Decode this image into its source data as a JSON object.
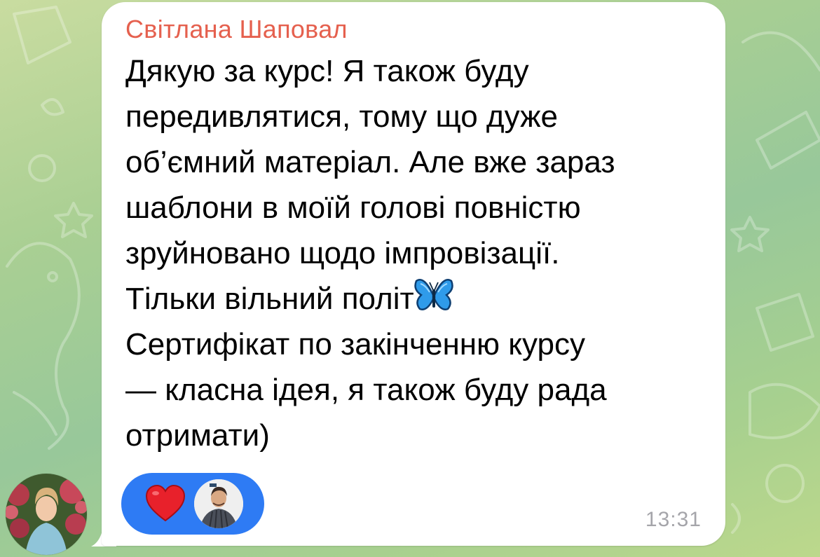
{
  "chat": {
    "background_color": "#a9cf93",
    "bubble_color": "#ffffff"
  },
  "message": {
    "sender_name": "Світлана Шаповал",
    "sender_color": "#e5604e",
    "lines": [
      "Дякую за курс! Я також буду",
      "передивлятися, тому що дуже",
      "об’ємний матеріал. Але вже зараз",
      "шаблони в моїй голові повністю",
      "зруйновано щодо імпровізації.",
      "Тільки вільний політ",
      "Сертифікат по закінченню курсу",
      "— класна ідея, я також буду рада",
      "отримати)"
    ],
    "inline_emoji": "blue-butterfly",
    "time": "13:31"
  },
  "reactions": [
    {
      "emoji": "red-heart",
      "reactor": "reactor-avatar",
      "chip_color": "#2e7bf4"
    }
  ],
  "sender_avatar": "sender-avatar"
}
